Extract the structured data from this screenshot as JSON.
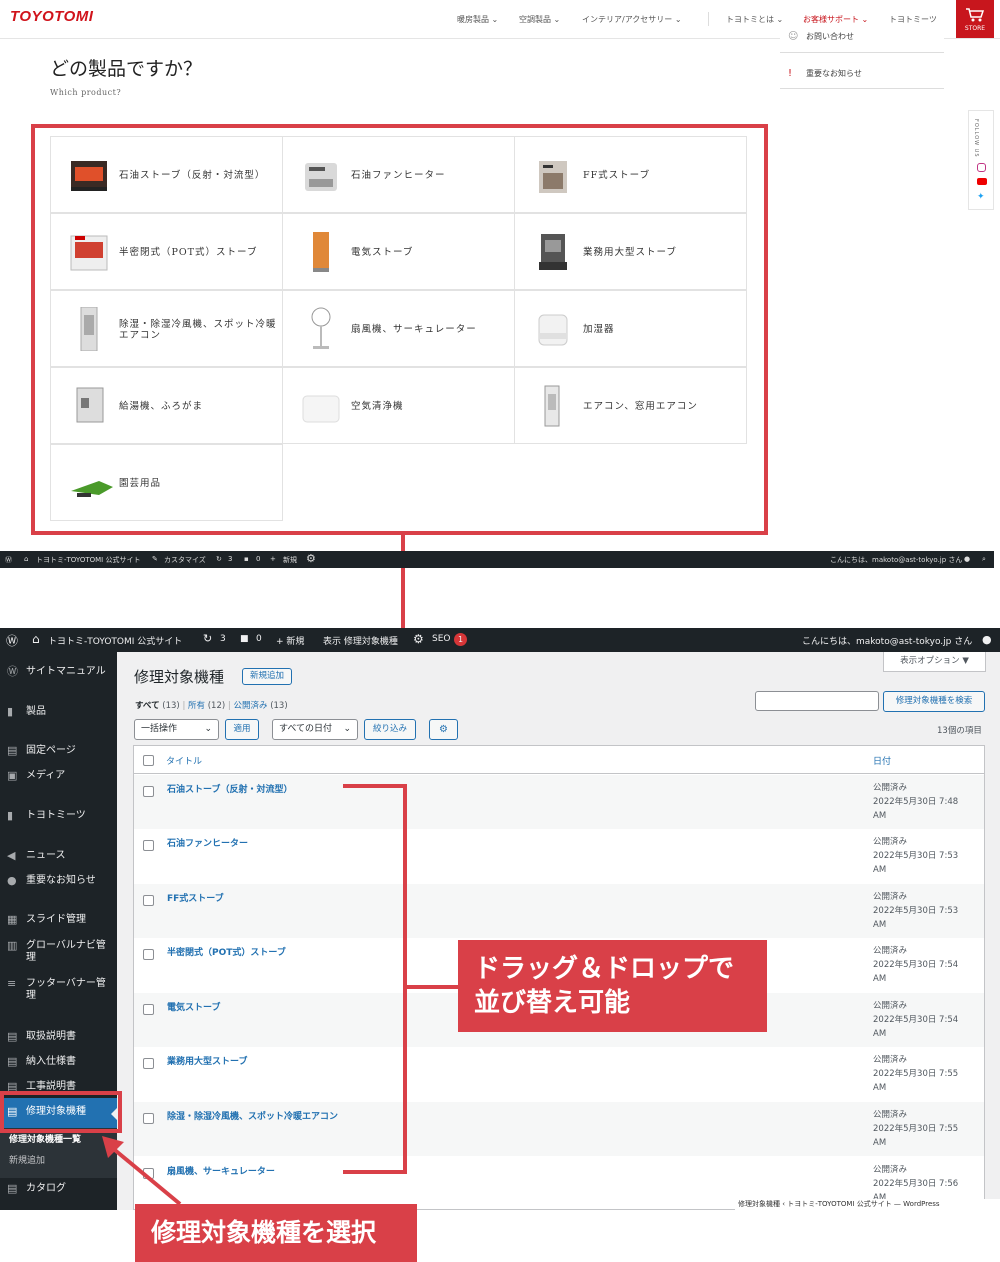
{
  "site": {
    "logo": "TOYOTOMI",
    "nav": [
      "暖房製品",
      "空調製品",
      "インテリア/アクセサリー",
      "トヨトミとは",
      "お客様サポート",
      "トヨトミーツ"
    ],
    "store_label": "STORE",
    "dropdown": [
      "お問い合わせ",
      "重要なお知らせ"
    ],
    "question_title": "どの製品ですか？",
    "question_sub": "Which product?",
    "follow_label": "FOLLOW US",
    "products": [
      "石油ストーブ（反射・対流型）",
      "石油ファンヒーター",
      "FF式ストーブ",
      "半密閉式（POT式）ストーブ",
      "電気ストーブ",
      "業務用大型ストーブ",
      "除湿・除湿冷風機、スポット冷暖エアコン",
      "扇風機、サーキュレーター",
      "加湿器",
      "給湯機、ふろがま",
      "空気清浄機",
      "エアコン、窓用エアコン",
      "園芸用品"
    ]
  },
  "admin_bar_top": {
    "site": "トヨトミ-TOYOTOMI 公式サイト",
    "customize": "カスタマイズ",
    "updates": "3",
    "comments": "0",
    "new": "新規",
    "greeting": "こんにちは、makoto@ast-tokyo.jp さん"
  },
  "wp": {
    "bar": {
      "site": "トヨトミ-TOYOTOMI 公式サイト",
      "updates": "3",
      "comments": "0",
      "new": "+ 新規",
      "view": "表示 修理対象機種",
      "seo": "SEO",
      "seo_count": "1",
      "greeting": "こんにちは、makoto@ast-tokyo.jp さん"
    },
    "sidebar": [
      "サイトマニュアル",
      "製品",
      "固定ページ",
      "メディア",
      "トヨトミーツ",
      "ニュース",
      "重要なお知らせ",
      "スライド管理",
      "グローバルナビ管理",
      "フッターバナー管理",
      "取扱説明書",
      "納入仕様書",
      "工事説明書",
      "修理対象機種",
      "修理対象機種一覧",
      "新規追加",
      "カタログ"
    ],
    "title": "修理対象機種",
    "add_new": "新規追加",
    "screen_options": "表示オプション ▼",
    "views": {
      "all": "すべて",
      "all_count": "(13)",
      "mine": "所有",
      "mine_count": "(12)",
      "published": "公開済み",
      "published_count": "(13)"
    },
    "search_button": "修理対象機種を検索",
    "search_value": "",
    "bulk_select": "一括操作",
    "apply": "適用",
    "date_select": "すべての日付",
    "filter": "絞り込み",
    "item_count": "13個の項目",
    "col_title": "タイトル",
    "col_date": "日付",
    "rows": [
      {
        "title": "石油ストーブ（反射・対流型）",
        "status": "公開済み",
        "date": "2022年5月30日 7:48",
        "ampm": "AM"
      },
      {
        "title": "石油ファンヒーター",
        "status": "公開済み",
        "date": "2022年5月30日 7:53",
        "ampm": "AM"
      },
      {
        "title": "FF式ストーブ",
        "status": "公開済み",
        "date": "2022年5月30日 7:53",
        "ampm": "AM"
      },
      {
        "title": "半密閉式（POT式）ストーブ",
        "status": "公開済み",
        "date": "2022年5月30日 7:54",
        "ampm": "AM"
      },
      {
        "title": "電気ストーブ",
        "status": "公開済み",
        "date": "2022年5月30日 7:54",
        "ampm": "AM"
      },
      {
        "title": "業務用大型ストーブ",
        "status": "公開済み",
        "date": "2022年5月30日 7:55",
        "ampm": "AM"
      },
      {
        "title": "除湿・除湿冷風機、スポット冷暖エアコン",
        "status": "公開済み",
        "date": "2022年5月30日 7:55",
        "ampm": "AM"
      },
      {
        "title": "扇風機、サーキュレーター",
        "status": "公開済み",
        "date": "2022年5月30日 7:56",
        "ampm": "AM"
      }
    ],
    "footer": "修理対象機種 ‹ トヨトミ-TOYOTOMI 公式サイト — WordPress"
  },
  "annotations": {
    "drag": [
      "ドラッグ＆ドロップで",
      "並び替え可能"
    ],
    "select": "修理対象機種を選択",
    "color": "#d94048"
  }
}
